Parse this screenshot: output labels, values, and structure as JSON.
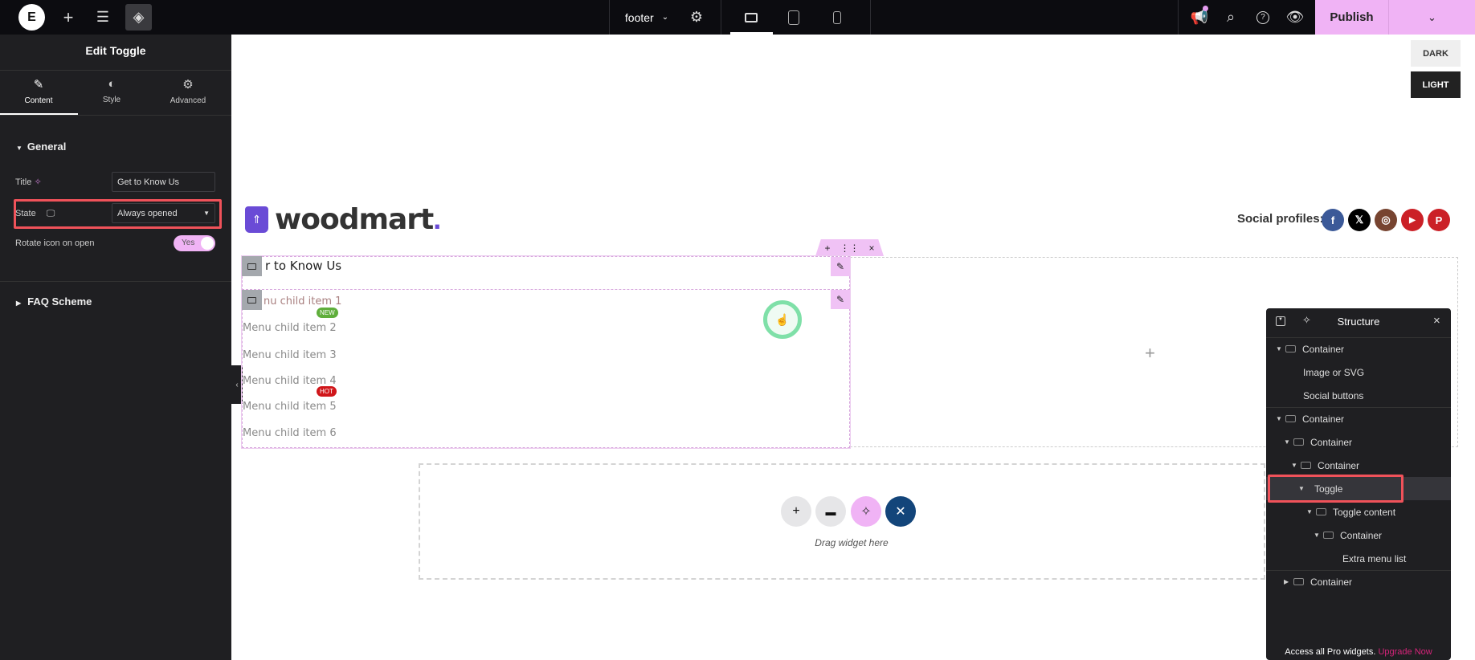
{
  "topbar": {
    "page_name": "footer",
    "publish_label": "Publish",
    "notification_dot_color": "#e59cf0"
  },
  "panel": {
    "title": "Edit Toggle",
    "tabs": [
      {
        "label": "Content",
        "icon": "pencil-icon"
      },
      {
        "label": "Style",
        "icon": "half-circle-icon"
      },
      {
        "label": "Advanced",
        "icon": "gear-icon"
      }
    ],
    "general_label": "General",
    "title_label": "Title",
    "title_value": "Get to Know Us",
    "state_label": "State",
    "state_value": "Always opened",
    "rotate_label": "Rotate icon on open",
    "rotate_value": "Yes",
    "faq_label": "FAQ Scheme"
  },
  "canvas": {
    "dark_label": "DARK",
    "light_label": "LIGHT",
    "logo_text": "woodmart",
    "logo_dot": ".",
    "social_label": "Social profiles:",
    "social": [
      {
        "name": "facebook",
        "glyph": "f",
        "color": "#3b5998"
      },
      {
        "name": "x",
        "glyph": "𝕏",
        "color": "#000000"
      },
      {
        "name": "instagram",
        "glyph": "◎",
        "color": "#774430"
      },
      {
        "name": "youtube",
        "glyph": "▶",
        "color": "#cb2027"
      },
      {
        "name": "pinterest",
        "glyph": "P",
        "color": "#cb2027"
      }
    ],
    "toggle_title": "r to Know Us",
    "menu_items": [
      "nu child item 1",
      "Menu child item 2",
      "Menu child item 3",
      "Menu child item 4",
      "Menu child item 5",
      "Menu child item 6"
    ],
    "badge_new": "NEW",
    "badge_hot": "HOT",
    "drag_label": "Drag widget here"
  },
  "structure": {
    "title": "Structure",
    "rows": [
      "Container",
      "Image or SVG",
      "Social buttons",
      "Container",
      "Container",
      "Container",
      "Toggle",
      "Toggle content",
      "Container",
      "Extra menu list",
      "Container"
    ],
    "footer_text": "Access all Pro widgets.",
    "upgrade_label": "Upgrade Now"
  }
}
